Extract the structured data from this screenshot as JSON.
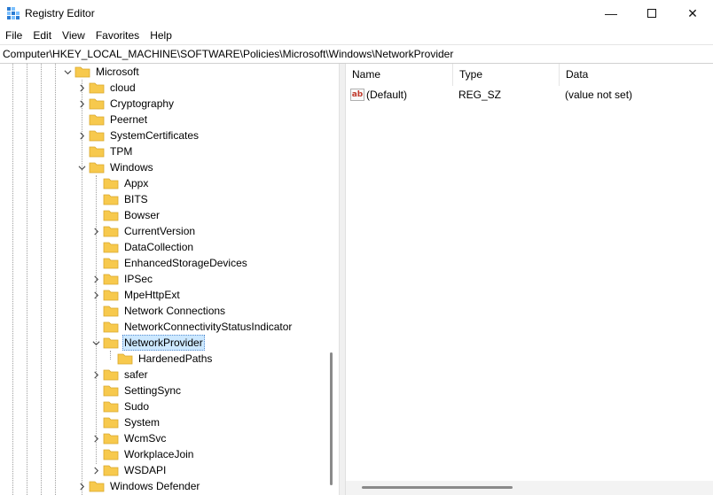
{
  "window": {
    "title": "Registry Editor",
    "minimize_glyph": "—",
    "close_glyph": "✕"
  },
  "menu": [
    "File",
    "Edit",
    "View",
    "Favorites",
    "Help"
  ],
  "address": "Computer\\HKEY_LOCAL_MACHINE\\SOFTWARE\\Policies\\Microsoft\\Windows\\NetworkProvider",
  "tree": {
    "microsoft": "Microsoft",
    "cloud": "cloud",
    "cryptography": "Cryptography",
    "peernet": "Peernet",
    "systemcertificates": "SystemCertificates",
    "tpm": "TPM",
    "windows": "Windows",
    "appx": "Appx",
    "bits": "BITS",
    "bowser": "Bowser",
    "currentversion": "CurrentVersion",
    "datacollection": "DataCollection",
    "enhancedstoragedevices": "EnhancedStorageDevices",
    "ipsec": "IPSec",
    "mpehttpext": "MpeHttpExt",
    "networkconnections": "Network Connections",
    "ncsi": "NetworkConnectivityStatusIndicator",
    "networkprovider": "NetworkProvider",
    "hardenedpaths": "HardenedPaths",
    "safer": "safer",
    "settingsync": "SettingSync",
    "sudo": "Sudo",
    "system": "System",
    "wcmsvc": "WcmSvc",
    "workplacejoin": "WorkplaceJoin",
    "wsdapi": "WSDAPI",
    "windowsdefender": "Windows Defender"
  },
  "list": {
    "headers": {
      "name": "Name",
      "type": "Type",
      "data": "Data"
    },
    "rows": [
      {
        "icon": "string-value-icon",
        "icon_text": "ab",
        "name": "(Default)",
        "type": "REG_SZ",
        "data": "(value not set)"
      }
    ]
  },
  "colors": {
    "folder": "#f7c94d",
    "selection": "#cce8ff",
    "accent": "#2a7bd3"
  }
}
